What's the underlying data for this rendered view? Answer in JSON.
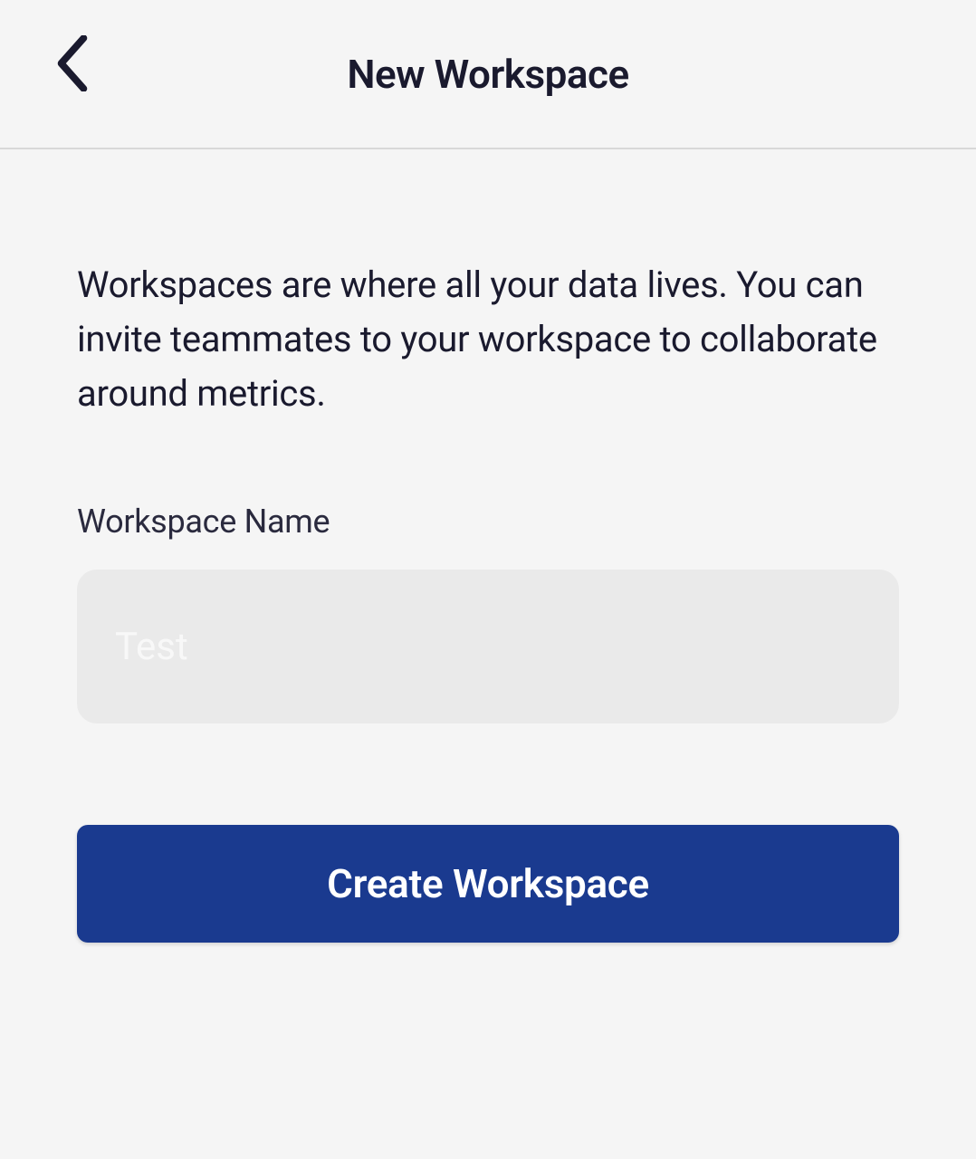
{
  "header": {
    "title": "New Workspace"
  },
  "main": {
    "description": "Workspaces are where all your data lives. You can invite teammates to your workspace to collaborate around metrics.",
    "field_label": "Workspace Name",
    "input_placeholder": "Test",
    "input_value": "",
    "button_label": "Create Workspace"
  },
  "colors": {
    "primary_button": "#1a3a8f",
    "background": "#f5f5f5",
    "input_background": "#eaeaea"
  }
}
